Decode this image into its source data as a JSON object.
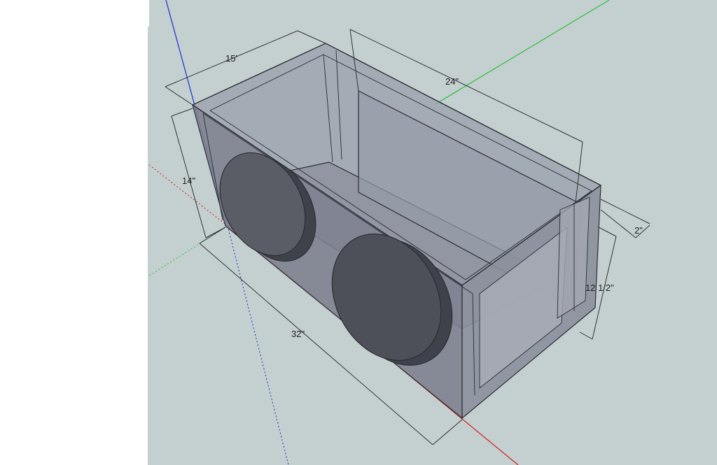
{
  "colors": {
    "viewport_bg": "#c4cfcf",
    "left_margin": "#ffffff",
    "axis_blue": "#1a2fd6",
    "axis_green": "#2bbf3a",
    "axis_red": "#d02020",
    "box_face": "#7d8190",
    "box_edge": "#2a2d33",
    "subwoofer": "#4d5059",
    "dimension_line": "#333333"
  },
  "dimensions": {
    "depth_top": "15'",
    "height_left": "14\"",
    "width_front": "32\"",
    "port_length": "24\"",
    "port_width": "2\"",
    "port_height": "12 1/2\""
  }
}
